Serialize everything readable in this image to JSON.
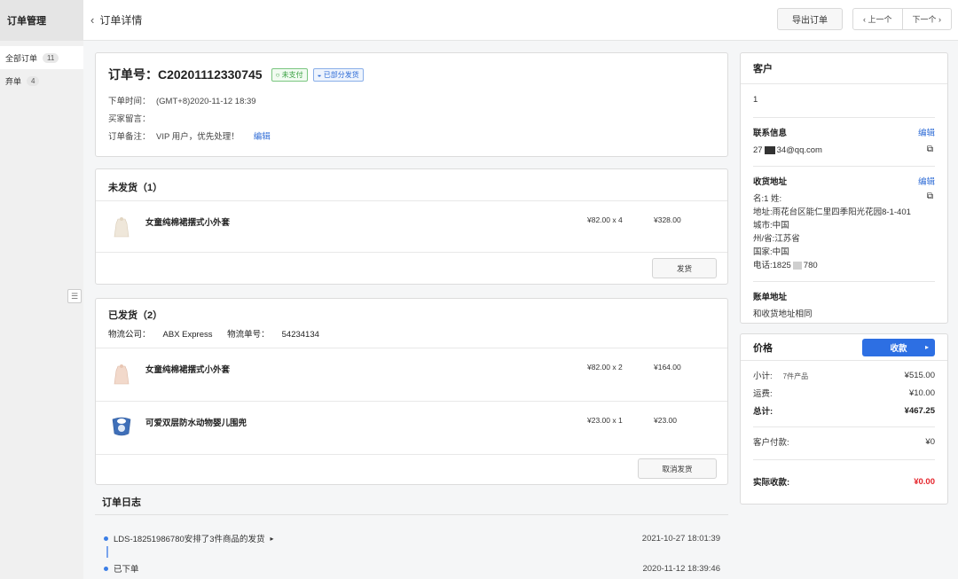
{
  "sidebar": {
    "title": "订单管理",
    "items": [
      {
        "label": "全部订单",
        "count": "11"
      },
      {
        "label": "弃单",
        "count": "4"
      }
    ]
  },
  "topbar": {
    "back_label": "订单详情",
    "export_label": "导出订单",
    "prev_label": "上一个",
    "next_label": "下一个"
  },
  "order": {
    "number_label": "订单号：",
    "number": "C20201112330745",
    "status_payment": "未支付",
    "status_ship": "已部分发货",
    "time_label": "下单时间：",
    "time_value": "(GMT+8)2020-11-12 18:39",
    "buyer_note_label": "买家留言：",
    "buyer_note_value": "",
    "remark_label": "订单备注：",
    "remark_value": "VIP 用户，优先处理！",
    "edit_label": "编辑"
  },
  "unshipped": {
    "title": "未发货（1）",
    "items": [
      {
        "name": "女童纯棉裙摆式小外套",
        "price_qty": "¥82.00 x 4",
        "total": "¥328.00"
      }
    ],
    "ship_button": "发货"
  },
  "shipped": {
    "title": "已发货（2）",
    "carrier_label": "物流公司：",
    "carrier": "ABX Express",
    "tracking_label": "物流单号：",
    "tracking": "54234134",
    "items": [
      {
        "name": "女童纯棉裙摆式小外套",
        "price_qty": "¥82.00 x 2",
        "total": "¥164.00"
      },
      {
        "name": "可爱双层防水动物婴儿围兜",
        "price_qty": "¥23.00 x 1",
        "total": "¥23.00"
      }
    ],
    "cancel_button": "取消发货"
  },
  "log": {
    "title": "订单日志",
    "entries": [
      {
        "text": "LDS-18251986780安排了3件商品的发货",
        "time": "2021-10-27 18:01:39"
      },
      {
        "text": "已下单",
        "time": "2020-11-12 18:39:46"
      }
    ]
  },
  "customer": {
    "title": "客户",
    "name": "1",
    "contact_title": "联系信息",
    "contact_edit": "编辑",
    "email_prefix": "27",
    "email_suffix": "34@qq.com",
    "address_title": "收货地址",
    "address_edit": "编辑",
    "address_lines": [
      "名:1 姓:",
      "地址:雨花台区能仁里四季阳光花园8-1-401",
      "城市:中国",
      "州/省:江苏省",
      "国家:中国"
    ],
    "phone_prefix": "电话:1825",
    "phone_suffix": "780",
    "billing_title": "账单地址",
    "billing_value": "和收货地址相同"
  },
  "price": {
    "title": "价格",
    "pay_button": "收款",
    "subtotal_label": "小计:",
    "subtotal_count": "7件产品",
    "subtotal_value": "¥515.00",
    "shipping_label": "运费:",
    "shipping_value": "¥10.00",
    "total_label": "总计:",
    "total_value": "¥467.25",
    "paid_label": "客户付款:",
    "paid_value": "¥0",
    "received_label": "实际收款:",
    "received_value": "¥0.00"
  }
}
